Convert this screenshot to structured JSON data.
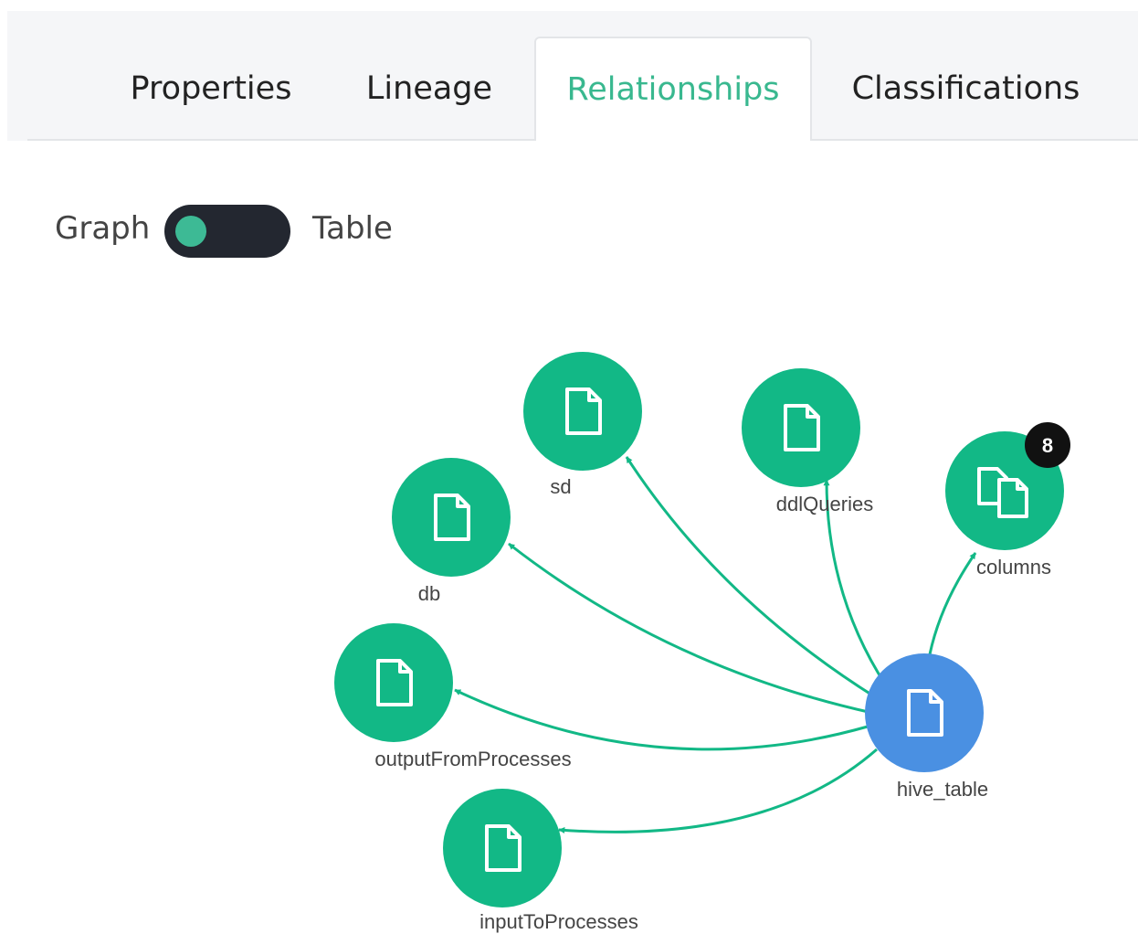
{
  "tabs": [
    {
      "label": "Properties",
      "active": false
    },
    {
      "label": "Lineage",
      "active": false
    },
    {
      "label": "Relationships",
      "active": true
    },
    {
      "label": "Classifications",
      "active": false
    }
  ],
  "view_toggle": {
    "left_label": "Graph",
    "right_label": "Table",
    "selected": "Graph"
  },
  "graph": {
    "colors": {
      "related": "#12b886",
      "center": "#4a90e2",
      "badge": "#111111",
      "edge": "#12b886"
    },
    "center": {
      "label": "hive_table",
      "icon": "file-icon"
    },
    "nodes": [
      {
        "label": "sd",
        "icon": "file-icon"
      },
      {
        "label": "ddlQueries",
        "icon": "file-icon"
      },
      {
        "label": "columns",
        "icon": "multi-file-icon",
        "badge": "8"
      },
      {
        "label": "db",
        "icon": "file-icon"
      },
      {
        "label": "outputFromProcesses",
        "icon": "file-icon"
      },
      {
        "label": "inputToProcesses",
        "icon": "file-icon"
      }
    ]
  }
}
